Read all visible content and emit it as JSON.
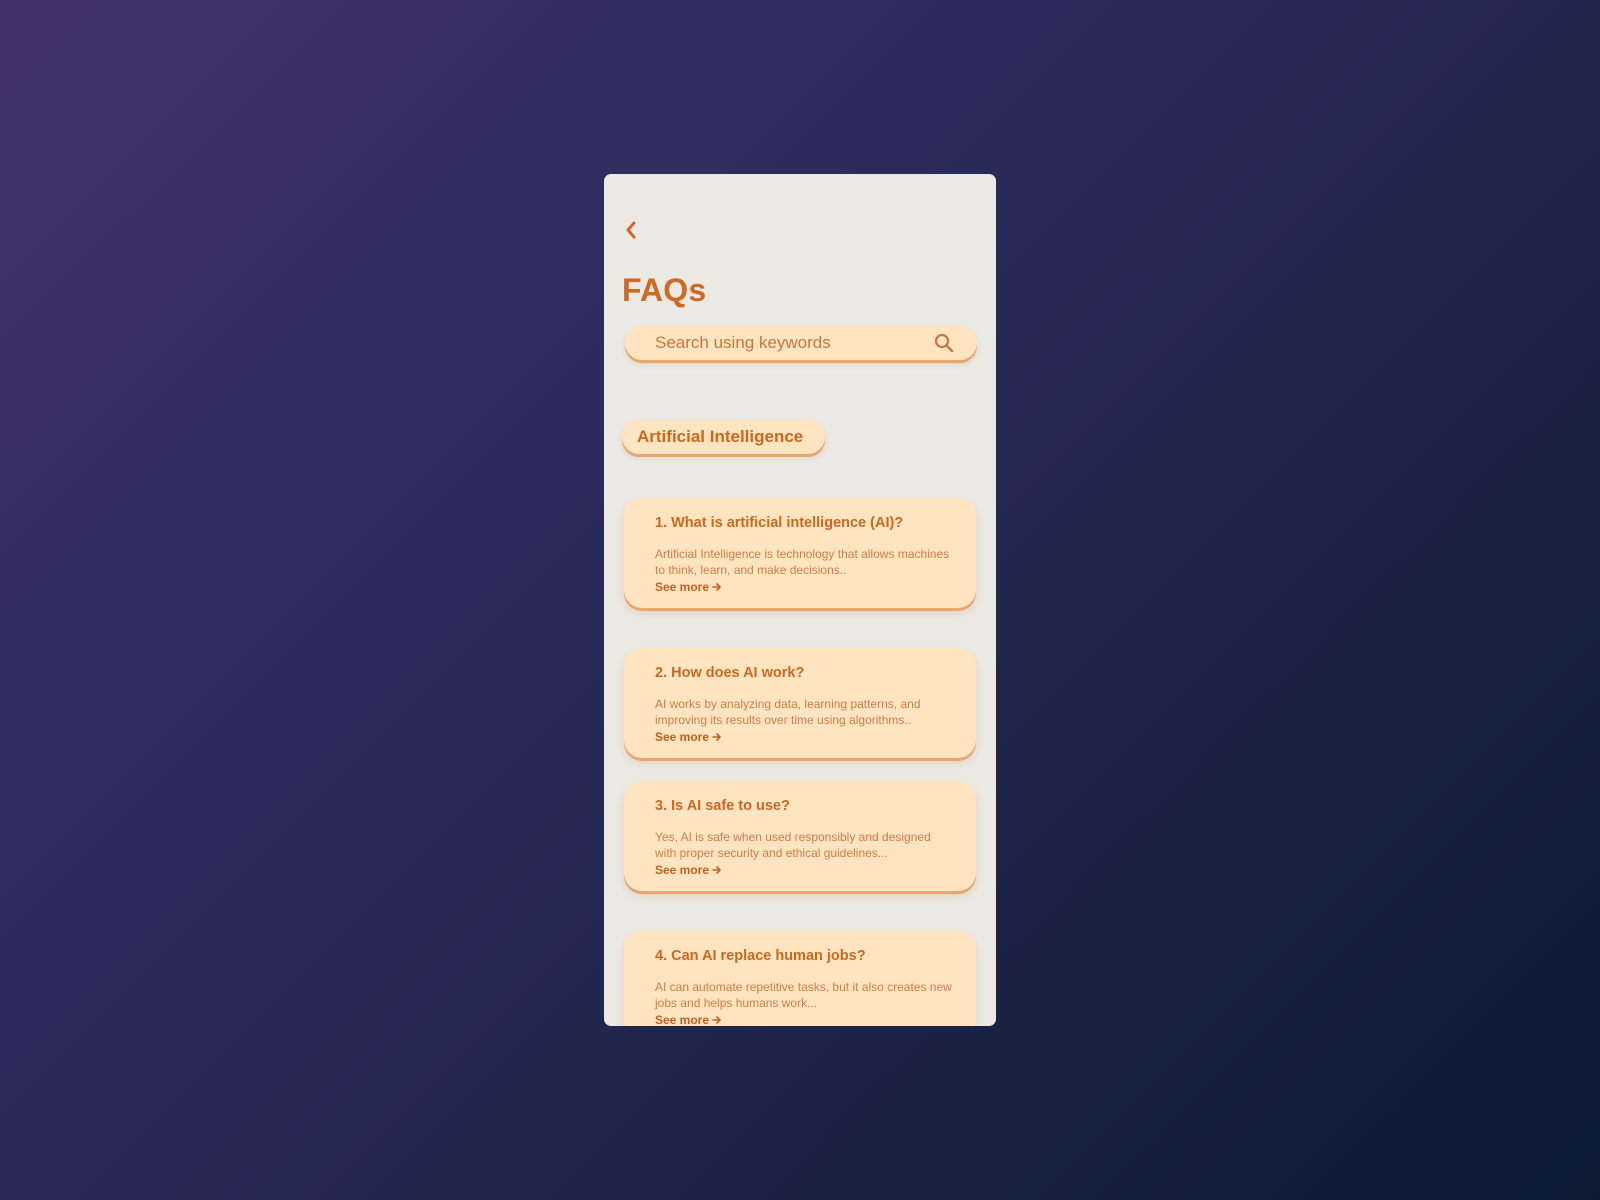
{
  "header": {
    "title": "FAQs",
    "back_icon": "chevron-left-icon"
  },
  "search": {
    "placeholder": "Search using keywords",
    "value": "",
    "icon": "search-icon"
  },
  "category": {
    "label": "Artificial Intelligence"
  },
  "faqs": [
    {
      "question": "1.  What is artificial intelligence (AI)?",
      "answer": "Artificial Intelligence is technology that allows machines to think, learn, and make decisions..",
      "link": "See more"
    },
    {
      "question": "2.  How does AI work?",
      "answer": "AI works by analyzing data, learning patterns, and improving its results over time using algorithms..",
      "link": "See more"
    },
    {
      "question": "3.  Is AI safe to use?",
      "answer": "Yes, AI is safe when used responsibly and designed with proper security and ethical guidelines...",
      "link": "See more"
    },
    {
      "question": "4.  Can AI replace human jobs?",
      "answer": "AI can automate repetitive tasks, but it also creates new jobs and helps humans work...",
      "link": "See more"
    }
  ],
  "colors": {
    "accent": "#cf6a25",
    "card_bg": "#fee4c1",
    "screen_bg": "#ebe9e3",
    "backdrop_start": "#43336c",
    "backdrop_end": "#0b1a32"
  }
}
